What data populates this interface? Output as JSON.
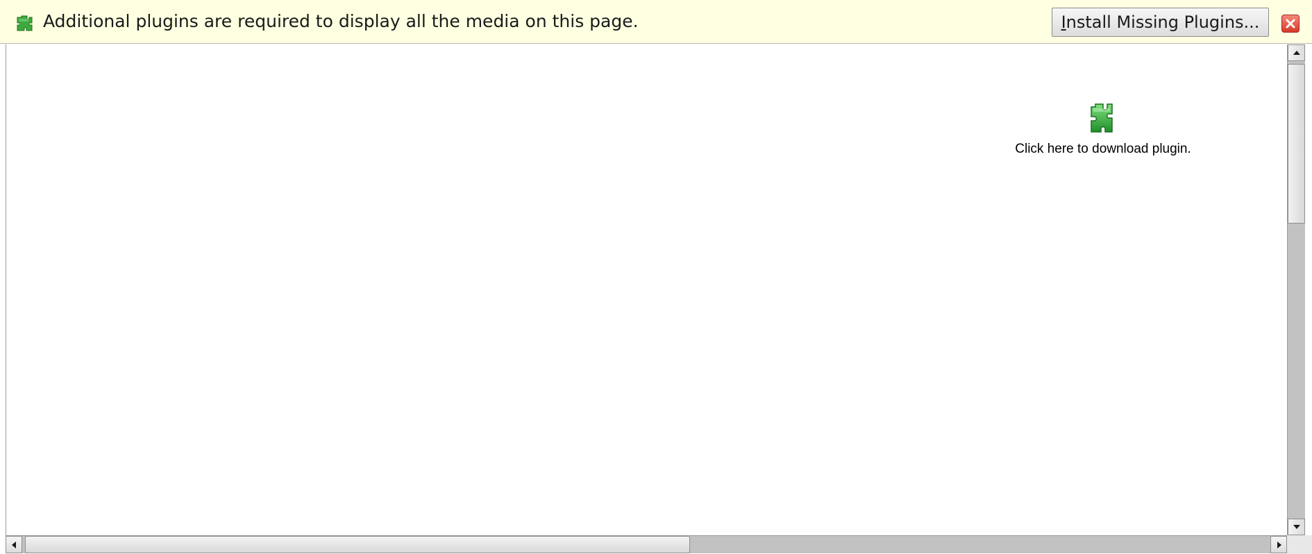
{
  "notification_bar": {
    "message": "Additional plugins are required to display all the media on this page.",
    "install_button": {
      "mnemonic": "I",
      "label_rest": "nstall Missing Plugins..."
    },
    "icon": "puzzle-piece-icon",
    "close_icon": "close-icon",
    "background_color": "#ffffe1"
  },
  "content": {
    "plugin_placeholder": {
      "icon": "puzzle-piece-icon",
      "text": "Click here to download plugin."
    }
  },
  "scrollbars": {
    "vertical": "visible",
    "horizontal": "visible"
  },
  "colors": {
    "plugin_green": "#3daa3d",
    "close_red": "#d6392a"
  }
}
